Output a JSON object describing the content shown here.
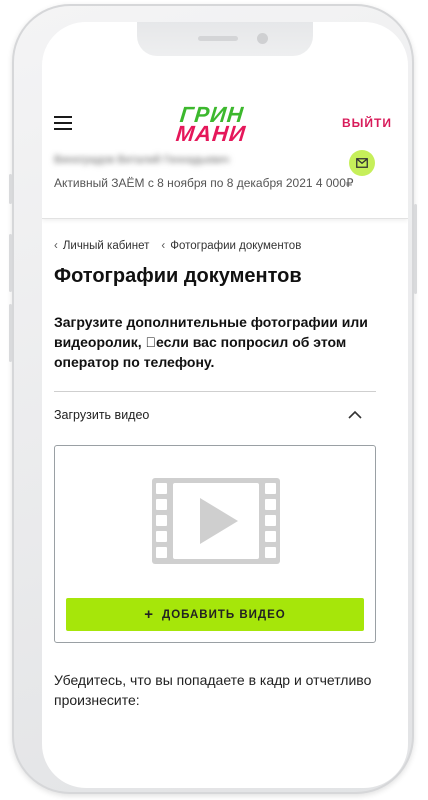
{
  "header": {
    "logo": {
      "line1": "ГРИН",
      "line2": "МАНИ",
      "line1_color": "#3cb82d",
      "line2_color": "#e5175a"
    },
    "logout_label": "ВЫЙТИ",
    "user_name": "Виноградов Виталий Геннадьевич",
    "loan_status": "Активный ЗАЁМ с 8 ноября по 8 декабря 2021 4 000₽",
    "icons": {
      "menu": "hamburger-icon",
      "mail": "mail-icon"
    }
  },
  "breadcrumb": {
    "items": [
      "Личный кабинет",
      "Фотографии документов"
    ]
  },
  "page": {
    "title": "Фотографии документов",
    "instruction": "Загрузите дополнительные фотографии или видеоролик, \u0000если вас попросил об этом оператор по телефону.",
    "accordion_title": "Загрузить видео",
    "add_video_label": "ДОБАВИТЬ ВИДЕО",
    "hint": "Убедитесь, что вы попадаете в кадр и отчетливо произнесите:"
  },
  "colors": {
    "accent_green": "#a6e60a",
    "mail_green": "#c6ef5a",
    "logout_pink": "#d81b5a"
  }
}
